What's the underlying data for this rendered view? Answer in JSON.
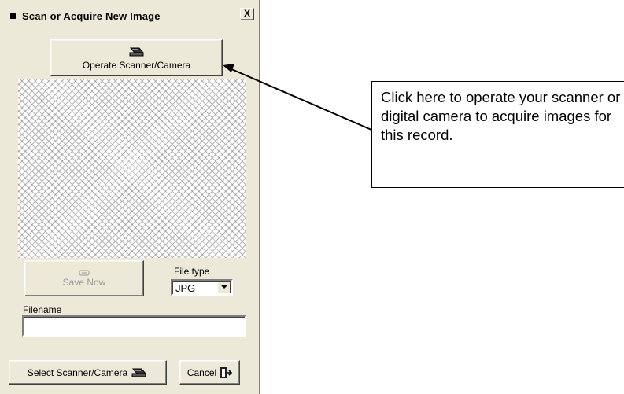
{
  "dialog": {
    "title": "Scan or Acquire New Image",
    "close_label": "X"
  },
  "operate_button": {
    "label": "Operate Scanner/Camera",
    "icon": "scanner-icon"
  },
  "save_button": {
    "label": "Save Now",
    "icon": "save-icon",
    "enabled": false
  },
  "file_type": {
    "label": "File type",
    "value": "JPG"
  },
  "filename": {
    "label": "Filename",
    "value": ""
  },
  "select_scanner_button": {
    "label_accel": "S",
    "label_rest": "elect Scanner/Camera",
    "icon": "scanner-icon"
  },
  "cancel_button": {
    "label": "Cancel",
    "icon": "exit-door-icon"
  },
  "annotation": {
    "text": "Click here to operate your scanner or digital camera to acquire images for this record."
  }
}
